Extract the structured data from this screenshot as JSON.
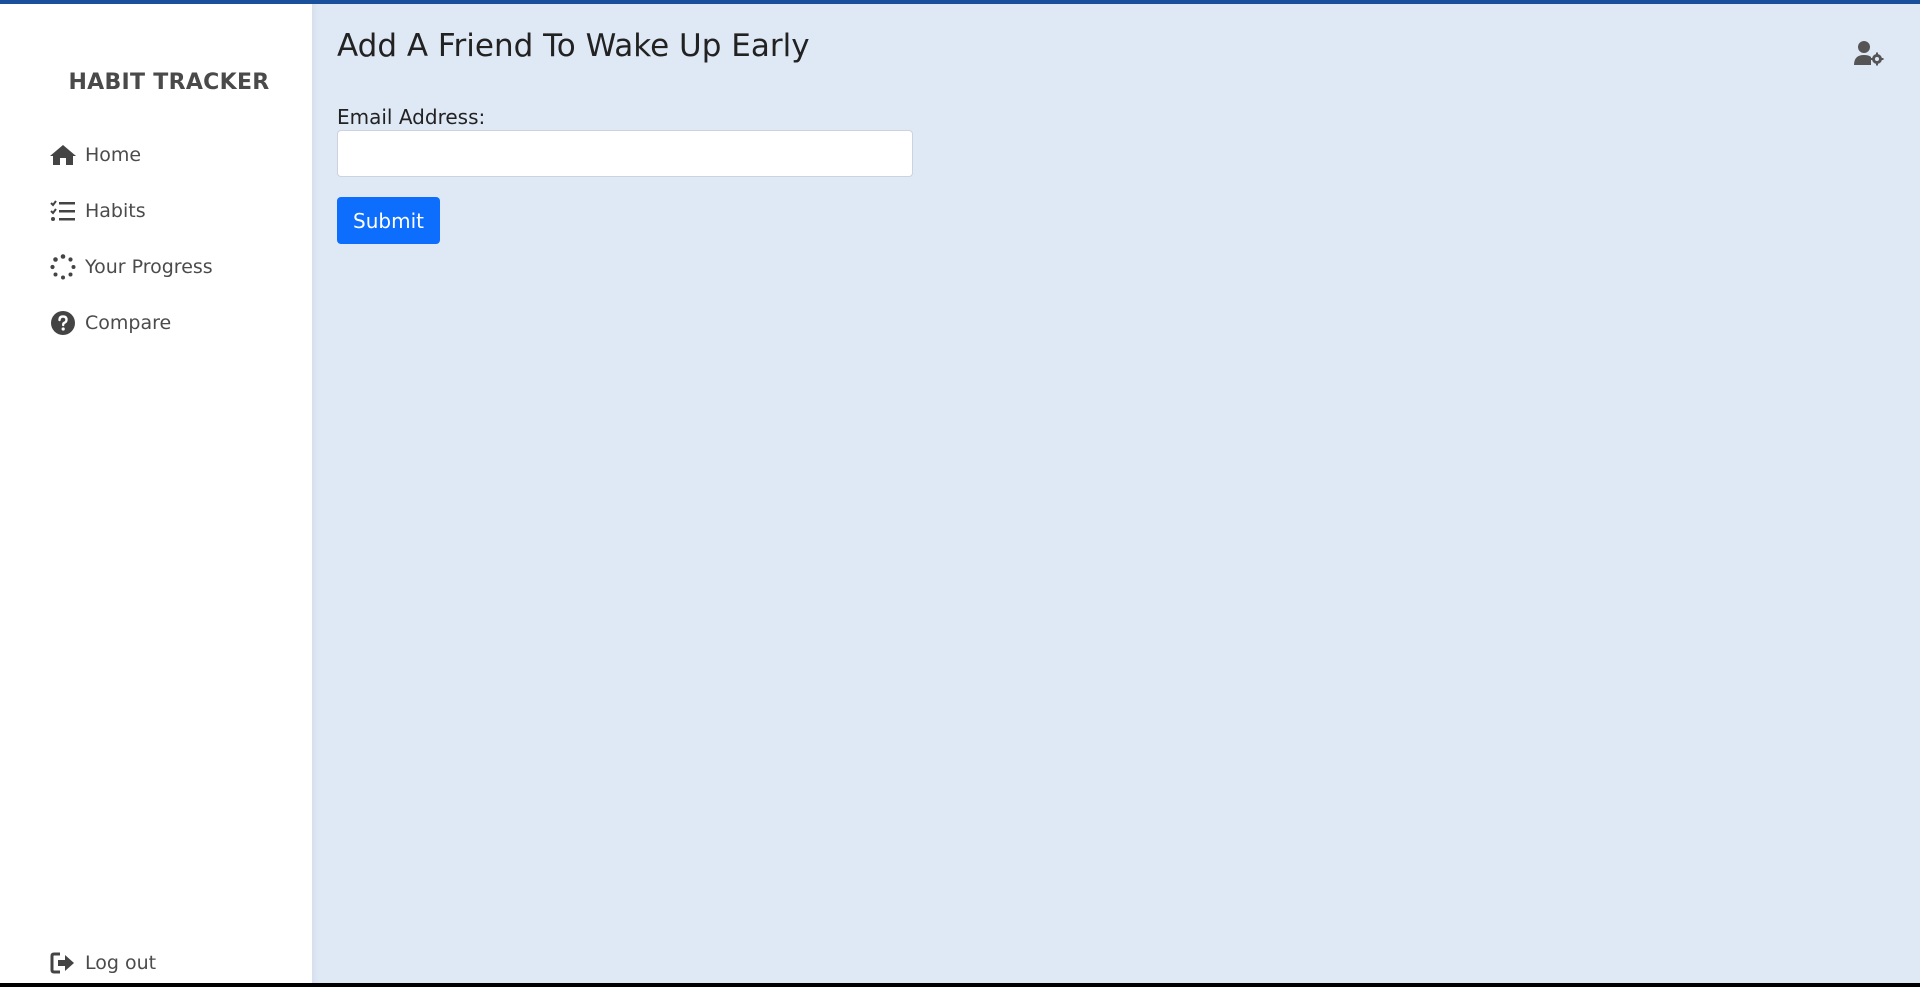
{
  "app": {
    "brand": "HABIT TRACKER"
  },
  "sidebar": {
    "items": [
      {
        "label": "Home",
        "icon": "home-icon"
      },
      {
        "label": "Habits",
        "icon": "checklist-icon"
      },
      {
        "label": "Your Progress",
        "icon": "spinner-icon"
      },
      {
        "label": "Compare",
        "icon": "question-circle-icon"
      }
    ],
    "logout_label": "Log out"
  },
  "main": {
    "title": "Add A Friend To Wake Up Early",
    "email_label": "Email Address:",
    "email_value": "",
    "submit_label": "Submit"
  },
  "colors": {
    "accent": "#0d6efd",
    "topbar": "#1a4f9c",
    "main_bg": "#dfe8f5",
    "sidebar_bg": "#ffffff"
  }
}
